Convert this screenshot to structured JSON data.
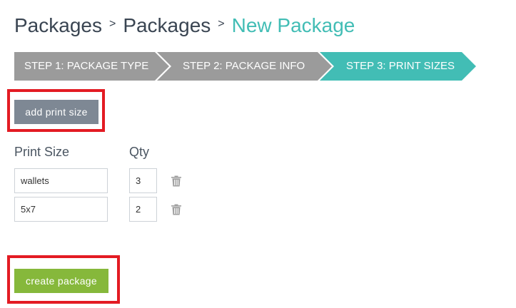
{
  "breadcrumb": {
    "items": [
      "Packages",
      "Packages"
    ],
    "separator": ">",
    "current": "New Package"
  },
  "steps": [
    {
      "label": "STEP 1: PACKAGE TYPE",
      "state": "complete"
    },
    {
      "label": "STEP 2: PACKAGE INFO",
      "state": "complete"
    },
    {
      "label": "STEP 3: PRINT SIZES",
      "state": "active"
    }
  ],
  "colors": {
    "step_inactive": "#9b9b9b",
    "step_active": "#42bdb5",
    "highlight": "#e31b23",
    "add_button": "#7e8894",
    "create_button": "#86b83b"
  },
  "actions": {
    "add_label": "add print size",
    "create_label": "create package"
  },
  "table": {
    "headers": {
      "size": "Print Size",
      "qty": "Qty"
    },
    "rows": [
      {
        "size": "wallets",
        "qty": "3",
        "delete_icon": "trash-icon"
      },
      {
        "size": "5x7",
        "qty": "2",
        "delete_icon": "trash-icon"
      }
    ]
  }
}
